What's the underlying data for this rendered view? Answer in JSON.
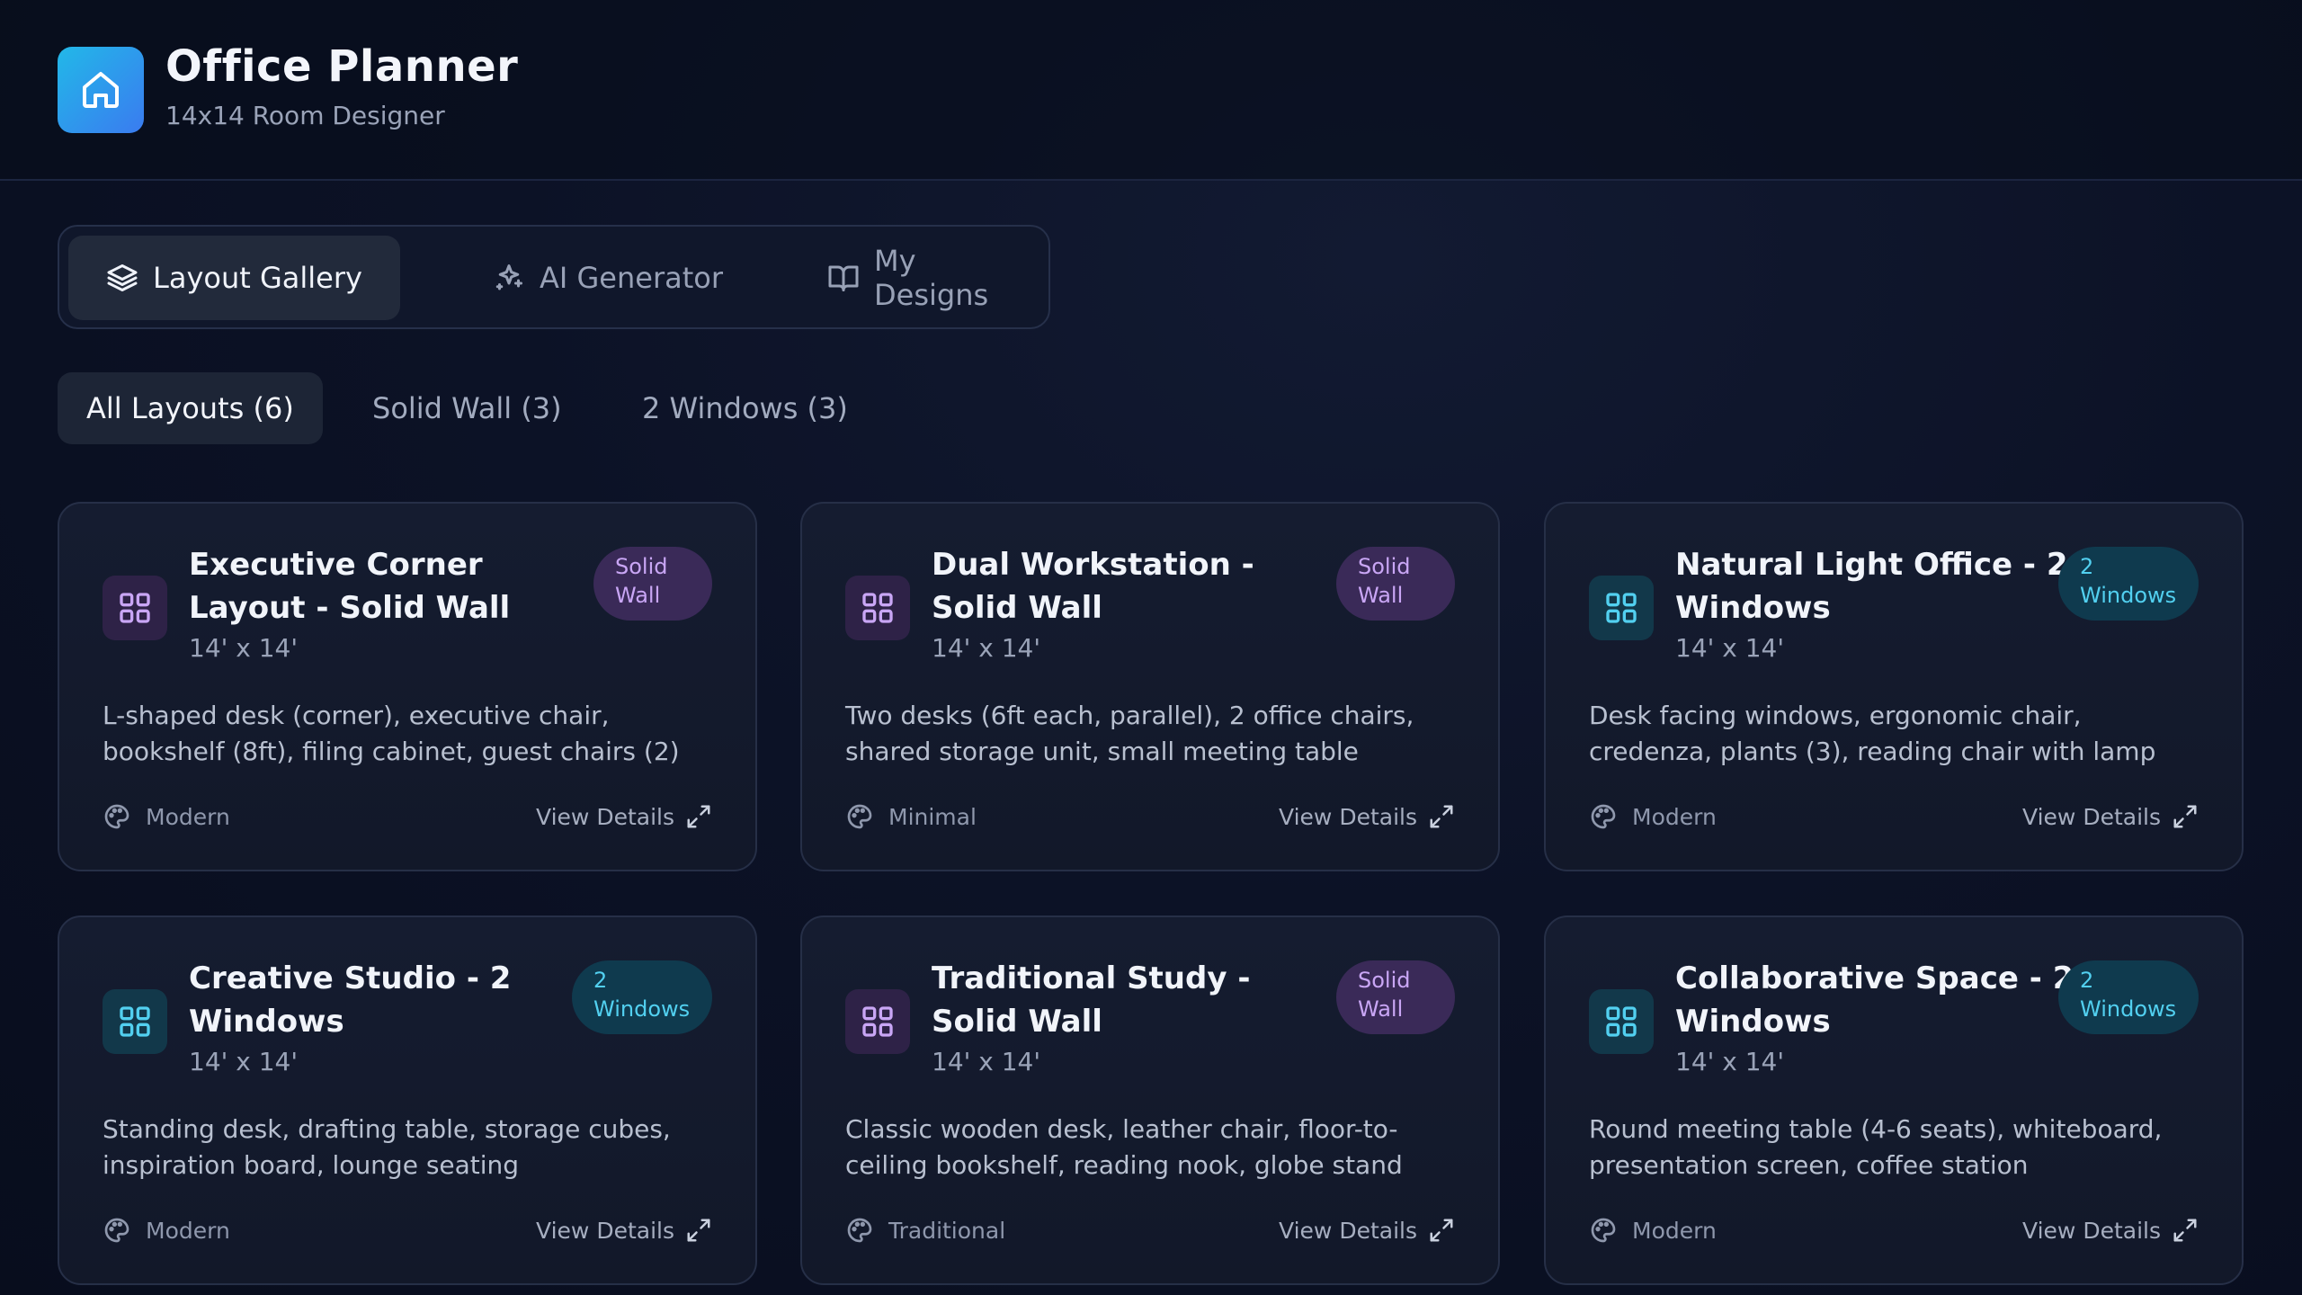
{
  "app": {
    "title": "Office Planner",
    "subtitle": "14x14 Room Designer",
    "logo_icon": "home-icon"
  },
  "tabs": [
    {
      "label": "Layout Gallery",
      "icon": "layers-icon",
      "active": true
    },
    {
      "label": "AI Generator",
      "icon": "sparkles-icon",
      "active": false
    },
    {
      "label": "My Designs",
      "icon": "book-open-icon",
      "active": false
    }
  ],
  "filters": [
    {
      "label": "All Layouts (6)",
      "active": true
    },
    {
      "label": "Solid Wall (3)",
      "active": false
    },
    {
      "label": "2 Windows (3)",
      "active": false
    }
  ],
  "cards": [
    {
      "title": "Executive Corner Layout - Solid Wall",
      "size": "14' x 14'",
      "badge": "Solid Wall",
      "badge_kind": "purple",
      "description": "L-shaped desk (corner), executive chair, bookshelf (8ft), filing cabinet, guest chairs (2)",
      "style": "Modern",
      "view_label": "View Details"
    },
    {
      "title": "Dual Workstation - Solid Wall",
      "size": "14' x 14'",
      "badge": "Solid Wall",
      "badge_kind": "purple",
      "description": "Two desks (6ft each, parallel), 2 office chairs, shared storage unit, small meeting table",
      "style": "Minimal",
      "view_label": "View Details"
    },
    {
      "title": "Natural Light Office - 2 Windows",
      "size": "14' x 14'",
      "badge": "2 Windows",
      "badge_kind": "teal",
      "description": "Desk facing windows, ergonomic chair, credenza, plants (3), reading chair with lamp",
      "style": "Modern",
      "view_label": "View Details"
    },
    {
      "title": "Creative Studio - 2 Windows",
      "size": "14' x 14'",
      "badge": "2 Windows",
      "badge_kind": "teal",
      "description": "Standing desk, drafting table, storage cubes, inspiration board, lounge seating",
      "style": "Modern",
      "view_label": "View Details"
    },
    {
      "title": "Traditional Study - Solid Wall",
      "size": "14' x 14'",
      "badge": "Solid Wall",
      "badge_kind": "purple",
      "description": "Classic wooden desk, leather chair, floor-to-ceiling bookshelf, reading nook, globe stand",
      "style": "Traditional",
      "view_label": "View Details"
    },
    {
      "title": "Collaborative Space - 2 Windows",
      "size": "14' x 14'",
      "badge": "2 Windows",
      "badge_kind": "teal",
      "description": "Round meeting table (4-6 seats), whiteboard, presentation screen, coffee station",
      "style": "Modern",
      "view_label": "View Details"
    }
  ],
  "colors": {
    "accent_purple": "#c9a6f5",
    "accent_teal": "#52d0f0",
    "logo_gradient_start": "#22b8e8",
    "logo_gradient_end": "#3a7bf0"
  }
}
